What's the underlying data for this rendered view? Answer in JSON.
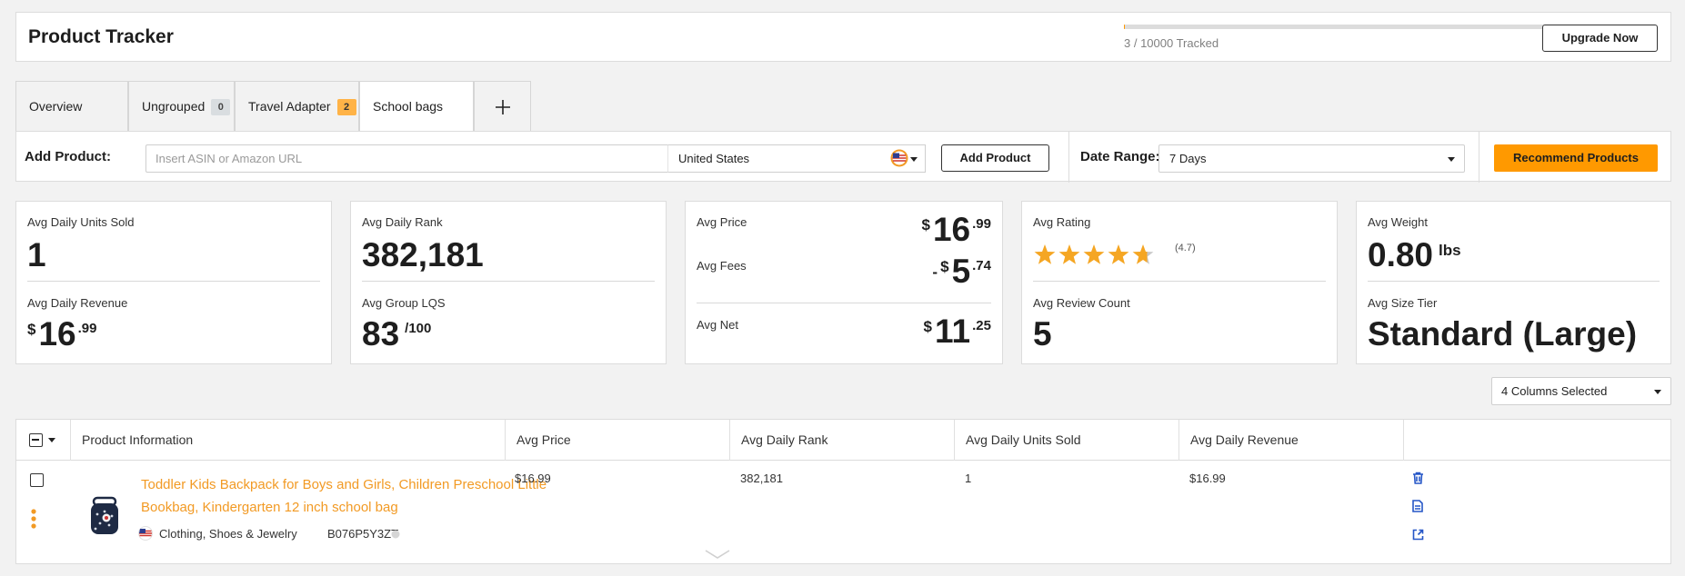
{
  "header": {
    "title": "Product Tracker",
    "tracked_text": "3 / 10000 Tracked",
    "tracked_fraction": 0.0003,
    "upgrade_label": "Upgrade Now"
  },
  "tabs": [
    {
      "label": "Overview"
    },
    {
      "label": "Ungrouped",
      "badge": "0"
    },
    {
      "label": "Travel Adapter",
      "badge": "2"
    },
    {
      "label": "School bags"
    },
    {
      "label": "+"
    }
  ],
  "toolbar": {
    "add_product_label": "Add Product:",
    "asin_placeholder": "Insert ASIN or Amazon URL",
    "country": "United States",
    "add_product_button": "Add Product",
    "date_range_label": "Date Range:",
    "date_range_value": "7 Days",
    "recommend_button": "Recommend Products"
  },
  "metrics": {
    "units_label": "Avg Daily Units Sold",
    "units_value": "1",
    "revenue_label": "Avg Daily Revenue",
    "revenue_currency": "$",
    "revenue_main": "16",
    "revenue_cents": ".99",
    "rank_label": "Avg Daily Rank",
    "rank_value": "382,181",
    "lqs_label": "Avg Group LQS",
    "lqs_value": "83",
    "lqs_suffix": "/100",
    "price_label": "Avg Price",
    "price_currency": "$",
    "price_main": "16",
    "price_cents": ".99",
    "fees_label": "Avg Fees",
    "fees_sign": "-",
    "fees_currency": "$",
    "fees_main": "5",
    "fees_cents": ".74",
    "net_label": "Avg Net",
    "net_currency": "$",
    "net_main": "11",
    "net_cents": ".25",
    "rating_label": "Avg Rating",
    "rating_value": 4.7,
    "rating_text": "(4.7)",
    "review_label": "Avg Review Count",
    "review_value": "5",
    "weight_label": "Avg Weight",
    "weight_value": "0.80",
    "weight_unit": "lbs",
    "size_label": "Avg Size Tier",
    "size_value": "Standard (Large)"
  },
  "columns_select": "4 Columns Selected",
  "table": {
    "headers": [
      "Product Information",
      "Avg Price",
      "Avg Daily Rank",
      "Avg Daily Units Sold",
      "Avg Daily Revenue"
    ],
    "rows": [
      {
        "title": "Toddler Kids Backpack for Boys and Girls, Children Preschool Little Bookbag, Kindergarten 12 inch school bag",
        "category": "Clothing, Shoes & Jewelry",
        "asin": "B076P5Y3ZT",
        "price": "$16.99",
        "rank": "382,181",
        "units": "1",
        "revenue": "$16.99"
      }
    ]
  },
  "colors": {
    "accent": "#ff9900",
    "link": "#f29a24",
    "icon_blue": "#2556c7"
  }
}
